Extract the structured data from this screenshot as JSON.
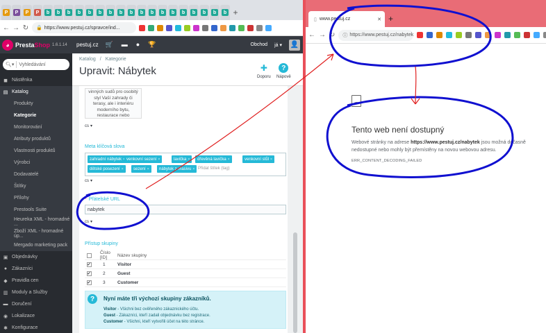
{
  "left_browser": {
    "tabs": [
      {
        "icon": "P",
        "color": "#e59a0e"
      },
      {
        "icon": "P",
        "color": "#7b4f9c"
      },
      {
        "icon": "P",
        "color": "#e59a0e"
      },
      {
        "icon": "P",
        "color": "#d15b4c"
      },
      {
        "icon": "b",
        "color": "#1fa896"
      },
      {
        "icon": "b",
        "color": "#1fa896"
      },
      {
        "icon": "b",
        "color": "#1fa896"
      },
      {
        "icon": "b",
        "color": "#1fa896"
      },
      {
        "icon": "b",
        "color": "#1fa896"
      },
      {
        "icon": "b",
        "color": "#1fa896"
      },
      {
        "icon": "b",
        "color": "#1fa896"
      },
      {
        "icon": "b",
        "color": "#1fa896"
      },
      {
        "icon": "b",
        "color": "#1fa896"
      },
      {
        "icon": "b",
        "color": "#1fa896"
      },
      {
        "icon": "b",
        "color": "#1fa896"
      },
      {
        "icon": "b",
        "color": "#1fa896"
      },
      {
        "icon": "b",
        "color": "#1fa896"
      },
      {
        "icon": "b",
        "color": "#1fa896"
      },
      {
        "icon": "b",
        "color": "#1fa896"
      },
      {
        "icon": "b",
        "color": "#1fa896"
      },
      {
        "icon": "b",
        "color": "#1fa896"
      },
      {
        "icon": "b",
        "color": "#1fa896"
      }
    ],
    "new_tab": "+",
    "url": "https://www.pestuj.cz/spravce/ind...",
    "ext_icons": [
      "#e33",
      "#3a7",
      "#d80",
      "#55c",
      "#2bd",
      "#9c2",
      "#c3c",
      "#777",
      "#36c",
      "#e94",
      "#29a",
      "#5b5",
      "#c33",
      "#888",
      "#4af"
    ]
  },
  "ps_header": {
    "brand_a": "Presta",
    "brand_b": "Shop",
    "version": "1.6.1.14",
    "shop_name": "pestuj.cz",
    "shop_btn": "Obchod",
    "lang": "já ▾"
  },
  "sidebar": {
    "search_placeholder": "Vyhledávání",
    "items_top": [
      {
        "label": "Nástěnka",
        "icon": "◼"
      },
      {
        "label": "Katalog",
        "icon": "▤",
        "active": true
      }
    ],
    "subitems": [
      {
        "label": "Produkty"
      },
      {
        "label": "Kategorie",
        "active": true
      },
      {
        "label": "Monitorování"
      },
      {
        "label": "Atributy produktů"
      },
      {
        "label": "Vlastnosti produktů"
      },
      {
        "label": "Výrobci"
      },
      {
        "label": "Dodavatelé"
      },
      {
        "label": "Štítky"
      },
      {
        "label": "Přílohy"
      },
      {
        "label": "Prestools Suite"
      },
      {
        "label": "Heureka XML - hromadné ..."
      },
      {
        "label": "Zboží XML - hromadné úp..."
      },
      {
        "label": "Mergado marketing pack"
      }
    ],
    "items_bottom": [
      {
        "label": "Objednávky",
        "icon": "▣"
      },
      {
        "label": "Zákazníci",
        "icon": "●"
      },
      {
        "label": "Pravidla cen",
        "icon": "◆"
      },
      {
        "label": "Moduly a Služby",
        "icon": "▥"
      },
      {
        "label": "Doručení",
        "icon": "▬"
      },
      {
        "label": "Lokalizace",
        "icon": "◉"
      },
      {
        "label": "Konfigurace",
        "icon": "✱"
      }
    ]
  },
  "page": {
    "breadcrumb": [
      "Katalog",
      "/",
      "Kategorie"
    ],
    "title": "Upravit: Nábytek",
    "tool_recommend": "Doporu",
    "tool_help": "Nápově"
  },
  "form": {
    "description_excerpt": "vinných sudů pro osobitý styl Vaší zahrady či terasy, ale i interiéru moderního bytu, restaurace nebo",
    "lang_code": "cs",
    "meta_keywords_label": "Meta klíčová slova",
    "tags": [
      "zahradní nábytek",
      "venkovní sezení",
      "lavička",
      "dřevěná lavička",
      "venkovní stůl",
      "dětské posezení",
      "sezení",
      "nábytek z masivu"
    ],
    "tag_placeholder": "Přidat štítek (tag)",
    "friendly_url_label": "Přátelské URL",
    "friendly_url_required": "*",
    "friendly_url_value": "nabytek",
    "group_access_label": "Přístup skupiny",
    "group_header_id": "Číslo [ID]",
    "group_header_name": "Název skupiny",
    "groups": [
      {
        "id": "1",
        "name": "Visitor",
        "checked": "✔"
      },
      {
        "id": "2",
        "name": "Guest",
        "checked": "✔"
      },
      {
        "id": "3",
        "name": "Customer",
        "checked": "✔"
      }
    ],
    "info_icon": "?",
    "info_title": "Nyní máte tři výchozí skupiny zákazníků.",
    "info_lines": [
      {
        "name": "Visitor",
        "text": " - Všichni bez ověřeného zákaznického účtu."
      },
      {
        "name": "Guest",
        "text": " - Zákazníci, kteří zadali objednávku bez registrace."
      },
      {
        "name": "Customer",
        "text": " - Všichni, kteří vytvořili účet na této stránce."
      }
    ]
  },
  "right_browser": {
    "tab_title": "www.pestuj.cz",
    "new_tab": "+",
    "url": "https://www.pestuj.cz/nabytek",
    "error_title": "Tento web není dostupný",
    "error_text_pre": "Webové stránky na adrese ",
    "error_url": "https://www.pestuj.cz/nabytek",
    "error_text_post": " jsou možná dočasně nedostupné nebo mohly být přemístěny na novou webovou adresu.",
    "error_code": "ERR_CONTENT_DECODING_FAILED",
    "ext_icons": [
      "#e33",
      "#36c",
      "#d80",
      "#2bd",
      "#9c2",
      "#777",
      "#55c",
      "#e94",
      "#c3c",
      "#29a",
      "#5b5",
      "#c33",
      "#4af",
      "#888"
    ]
  },
  "annotation_colors": {
    "circle": "#1010d0",
    "arrow": "#e02020"
  }
}
